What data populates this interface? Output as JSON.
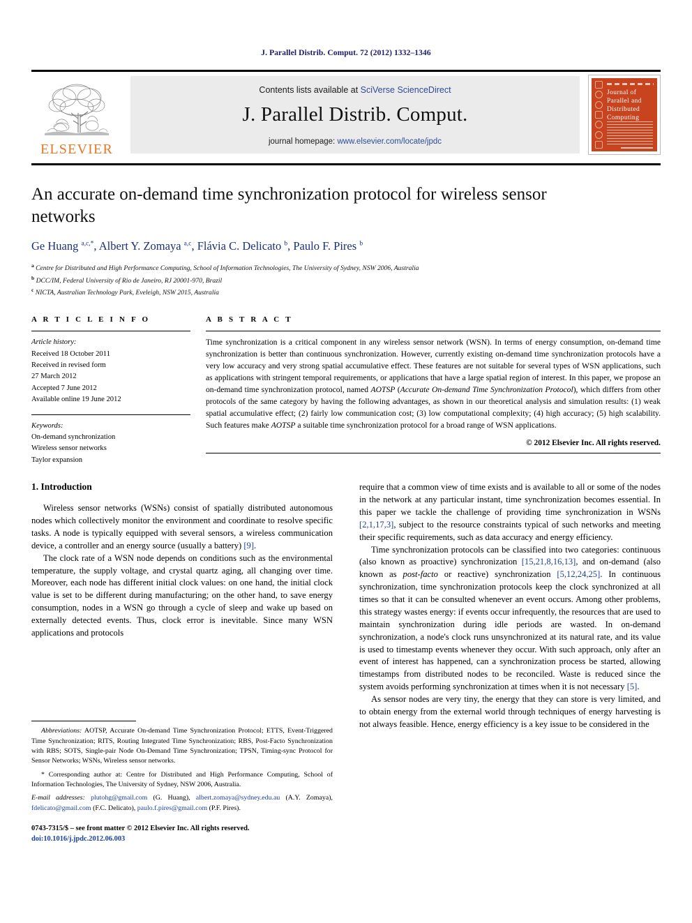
{
  "running_head": "J. Parallel Distrib. Comput. 72 (2012) 1332–1346",
  "masthead": {
    "publisher_name": "ELSEVIER",
    "contents_prefix": "Contents lists available at ",
    "contents_link": "SciVerse ScienceDirect",
    "journal_title": "J. Parallel Distrib. Comput.",
    "homepage_prefix": "journal homepage: ",
    "homepage_url": "www.elsevier.com/locate/jpdc",
    "cover_title": "Journal of Parallel and Distributed Computing",
    "accent_orange": "#E87722",
    "link_blue": "#2b4b9b",
    "cover_red": "#C8441F"
  },
  "article": {
    "title": "An accurate on-demand time synchronization protocol for wireless sensor networks",
    "authors_html": "Ge Huang <sup>a,c,</sup><sup>*</sup>, Albert Y. Zomaya <sup>a,c</sup>, Flávia C. Delicato <sup>b</sup>, Paulo F. Pires <sup>b</sup>",
    "affiliations": [
      {
        "marker": "a",
        "text": "Centre for Distributed and High Performance Computing, School of Information Technologies, The University of Sydney, NSW 2006, Australia"
      },
      {
        "marker": "b",
        "text": "DCC/IM, Federal University of Rio de Janeiro, RJ 20001-970, Brazil"
      },
      {
        "marker": "c",
        "text": "NICTA, Australian Technology Park, Eveleigh, NSW 2015, Australia"
      }
    ]
  },
  "article_info": {
    "heading": "A R T I C L E  I N F O",
    "history_label": "Article history:",
    "history": [
      "Received 18 October 2011",
      "Received in revised form",
      "27 March 2012",
      "Accepted 7 June 2012",
      "Available online 19 June 2012"
    ],
    "keywords_label": "Keywords:",
    "keywords": [
      "On-demand synchronization",
      "Wireless sensor networks",
      "Taylor expansion"
    ]
  },
  "abstract": {
    "heading": "A B S T R A C T",
    "part1": "Time synchronization is a critical component in any wireless sensor network (WSN). In terms of energy consumption, on-demand time synchronization is better than continuous synchronization. However, currently existing on-demand time synchronization protocols have a very low accuracy and very strong spatial accumulative effect. These features are not suitable for several types of WSN applications, such as applications with stringent temporal requirements, or applications that have a large spatial region of interest. In this paper, we propose an on-demand time synchronization protocol, named ",
    "italic1": "AOTSP",
    "part2": " (",
    "italic2": "Accurate On-demand Time Synchronization Protocol",
    "part3": "), which differs from other protocols of the same category by having the following advantages, as shown in our theoretical analysis and simulation results: (1) weak spatial accumulative effect; (2) fairly low communication cost; (3) low computational complexity; (4) high accuracy; (5) high scalability. Such features make ",
    "italic3": "AOTSP",
    "part4": " a suitable time synchronization protocol for a broad range of WSN applications.",
    "copyright": "© 2012 Elsevier Inc. All rights reserved."
  },
  "body": {
    "section_number_title": "1. Introduction",
    "left_para1": "Wireless sensor networks (WSNs) consist of spatially distributed autonomous nodes which collectively monitor the environment and coordinate to resolve specific tasks. A node is typically equipped with several sensors, a wireless communication device, a controller and an energy source (usually a battery) ",
    "left_para1_ref": "[9]",
    "left_para1_end": ".",
    "left_para2": "The clock rate of a WSN node depends on conditions such as the environmental temperature, the supply voltage, and crystal quartz aging, all changing over time. Moreover, each node has different initial clock values: on one hand, the initial clock value is set to be different during manufacturing; on the other hand, to save energy consumption, nodes in a WSN go through a cycle of sleep and wake up based on externally detected events. Thus, clock error is inevitable. Since many WSN applications and protocols",
    "right_para1a": "require that a common view of time exists and is available to all or some of the nodes in the network at any particular instant, time synchronization becomes essential. In this paper we tackle the challenge of providing time synchronization in WSNs ",
    "right_para1_ref": "[2,1,17,3]",
    "right_para1b": ", subject to the resource constraints typical of such networks and meeting their specific requirements, such as data accuracy and energy efficiency.",
    "right_para2a": "Time synchronization protocols can be classified into two categories: continuous (also known as proactive) synchronization ",
    "right_para2_ref1": "[15,21,8,16,13]",
    "right_para2b": ", and on-demand (also known as ",
    "right_para2_it": "post-facto",
    "right_para2c": " or reactive) synchronization ",
    "right_para2_ref2": "[5,12,24,25]",
    "right_para2d": ". In continuous synchronization, time synchronization protocols keep the clock synchronized at all times so that it can be consulted whenever an event occurs. Among other problems, this strategy wastes energy: if events occur infrequently, the resources that are used to maintain synchronization during idle periods are wasted. In on-demand synchronization, a node's clock runs unsynchronized at its natural rate, and its value is used to timestamp events whenever they occur. With such approach, only after an event of interest has happened, can a synchronization process be started, allowing timestamps from distributed nodes to be reconciled. Waste is reduced since the system avoids performing synchronization at times when it is not necessary ",
    "right_para2_ref3": "[5]",
    "right_para2e": ".",
    "right_para3": "As sensor nodes are very tiny, the energy that they can store is very limited, and to obtain energy from the external world through techniques of energy harvesting is not always feasible. Hence, energy efficiency is a key issue to be considered in the"
  },
  "footnotes": {
    "abbrev_label": "Abbreviations:",
    "abbrev_text": " AOTSP, Accurate On-demand Time Synchronization Protocol; ETTS, Event-Triggered Time Synchronization; RITS, Routing Integrated Time Synchronization; RBS, Post-Facto Synchronization with RBS; SOTS, Single-pair Node On-Demand Time Synchronization; TPSN, Timing-sync Protocol for Sensor Networks; WSNs, Wireless sensor networks.",
    "corresponding": "* Corresponding author at: Centre for Distributed and High Performance Computing, School of Information Technologies, The University of Sydney, NSW 2006, Australia.",
    "email_label": "E-mail addresses:",
    "emails": [
      {
        "addr": "plutohg@gmail.com",
        "name": " (G. Huang),"
      },
      {
        "addr": "albert.zomaya@sydney.edu.au",
        "name": " (A.Y. Zomaya),"
      },
      {
        "addr": "fdelicato@gmail.com",
        "name": " (F.C. Delicato),"
      },
      {
        "addr": "paulo.f.pires@gmail.com",
        "name": " (P.F. Pires)."
      }
    ],
    "issn_line": "0743-7315/$ – see front matter © 2012 Elsevier Inc. All rights reserved.",
    "doi_line": "doi:10.1016/j.jpdc.2012.06.003"
  }
}
